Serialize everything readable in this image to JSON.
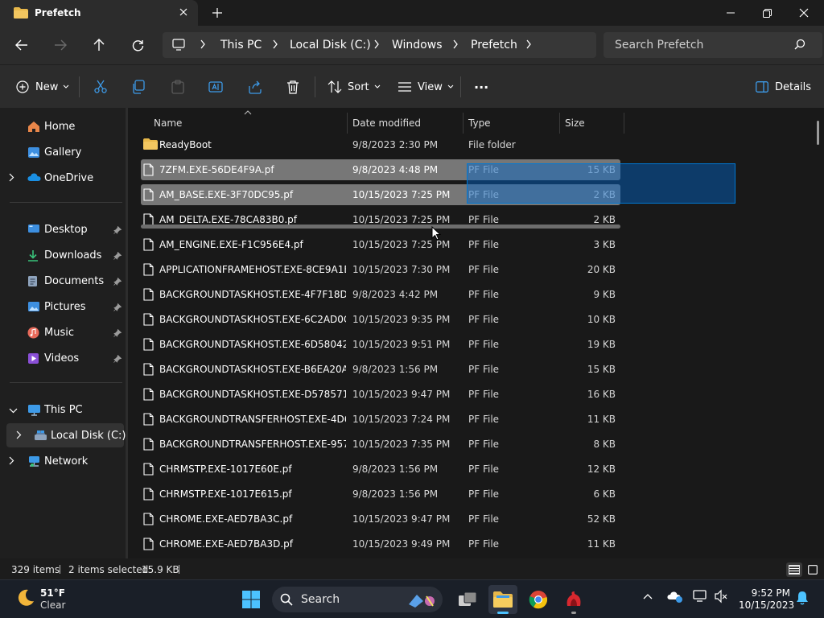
{
  "window": {
    "tab_title": "Prefetch",
    "new_tab_symbol": "+",
    "controls": [
      "minimize",
      "restore",
      "close"
    ]
  },
  "address": {
    "breadcrumbs": [
      "This PC",
      "Local Disk (C:)",
      "Windows",
      "Prefetch"
    ],
    "search_placeholder": "Search Prefetch"
  },
  "toolbar": {
    "new_label": "New",
    "sort_label": "Sort",
    "view_label": "View",
    "more_label": "···",
    "details_label": "Details"
  },
  "sidebar": {
    "home": "Home",
    "gallery": "Gallery",
    "onedrive": "OneDrive",
    "desktop": "Desktop",
    "downloads": "Downloads",
    "documents": "Documents",
    "pictures": "Pictures",
    "music": "Music",
    "videos": "Videos",
    "this_pc": "This PC",
    "local_disk": "Local Disk (C:)",
    "network": "Network"
  },
  "columns": {
    "name": "Name",
    "date": "Date modified",
    "type": "Type",
    "size": "Size"
  },
  "files": [
    {
      "name": "ReadyBoot",
      "date": "9/8/2023 2:30 PM",
      "type": "File folder",
      "size": "",
      "kind": "folder",
      "selected": false
    },
    {
      "name": "7ZFM.EXE-56DE4F9A.pf",
      "date": "9/8/2023 4:48 PM",
      "type": "PF File",
      "size": "15 KB",
      "kind": "file",
      "selected": true
    },
    {
      "name": "AM_BASE.EXE-3F70DC95.pf",
      "date": "10/15/2023 7:25 PM",
      "type": "PF File",
      "size": "2 KB",
      "kind": "file",
      "selected": true
    },
    {
      "name": "AM_DELTA.EXE-78CA83B0.pf",
      "date": "10/15/2023 7:25 PM",
      "type": "PF File",
      "size": "2 KB",
      "kind": "file",
      "selected": false
    },
    {
      "name": "AM_ENGINE.EXE-F1C956E4.pf",
      "date": "10/15/2023 7:25 PM",
      "type": "PF File",
      "size": "3 KB",
      "kind": "file",
      "selected": false
    },
    {
      "name": "APPLICATIONFRAMEHOST.EXE-8CE9A1E...",
      "date": "10/15/2023 7:30 PM",
      "type": "PF File",
      "size": "20 KB",
      "kind": "file",
      "selected": false
    },
    {
      "name": "BACKGROUNDTASKHOST.EXE-4F7F18DA...",
      "date": "9/8/2023 4:42 PM",
      "type": "PF File",
      "size": "9 KB",
      "kind": "file",
      "selected": false
    },
    {
      "name": "BACKGROUNDTASKHOST.EXE-6C2AD0C...",
      "date": "10/15/2023 9:35 PM",
      "type": "PF File",
      "size": "10 KB",
      "kind": "file",
      "selected": false
    },
    {
      "name": "BACKGROUNDTASKHOST.EXE-6D58042C....",
      "date": "10/15/2023 9:51 PM",
      "type": "PF File",
      "size": "19 KB",
      "kind": "file",
      "selected": false
    },
    {
      "name": "BACKGROUNDTASKHOST.EXE-B6EA20AF...",
      "date": "9/8/2023 1:56 PM",
      "type": "PF File",
      "size": "15 KB",
      "kind": "file",
      "selected": false
    },
    {
      "name": "BACKGROUNDTASKHOST.EXE-D5785712.pf",
      "date": "10/15/2023 9:47 PM",
      "type": "PF File",
      "size": "16 KB",
      "kind": "file",
      "selected": false
    },
    {
      "name": "BACKGROUNDTRANSFERHOST.EXE-4D6E...",
      "date": "10/15/2023 7:24 PM",
      "type": "PF File",
      "size": "11 KB",
      "kind": "file",
      "selected": false
    },
    {
      "name": "BACKGROUNDTRANSFERHOST.EXE-9576...",
      "date": "10/15/2023 7:35 PM",
      "type": "PF File",
      "size": "8 KB",
      "kind": "file",
      "selected": false
    },
    {
      "name": "CHRMSTP.EXE-1017E60E.pf",
      "date": "9/8/2023 1:56 PM",
      "type": "PF File",
      "size": "12 KB",
      "kind": "file",
      "selected": false
    },
    {
      "name": "CHRMSTP.EXE-1017E615.pf",
      "date": "9/8/2023 1:56 PM",
      "type": "PF File",
      "size": "6 KB",
      "kind": "file",
      "selected": false
    },
    {
      "name": "CHROME.EXE-AED7BA3C.pf",
      "date": "10/15/2023 9:47 PM",
      "type": "PF File",
      "size": "52 KB",
      "kind": "file",
      "selected": false
    },
    {
      "name": "CHROME.EXE-AED7BA3D.pf",
      "date": "10/15/2023 9:49 PM",
      "type": "PF File",
      "size": "11 KB",
      "kind": "file",
      "selected": false
    }
  ],
  "status": {
    "item_count": "329 items",
    "selection": "2 items selected",
    "selection_size": "15.9 KB"
  },
  "taskbar": {
    "weather_temp": "51°F",
    "weather_cond": "Clear",
    "search_label": "Search",
    "time": "9:52 PM",
    "date": "10/15/2023"
  },
  "colors": {
    "accent": "#0078d4",
    "folder": "#e8b84a",
    "selection": "#777777"
  }
}
